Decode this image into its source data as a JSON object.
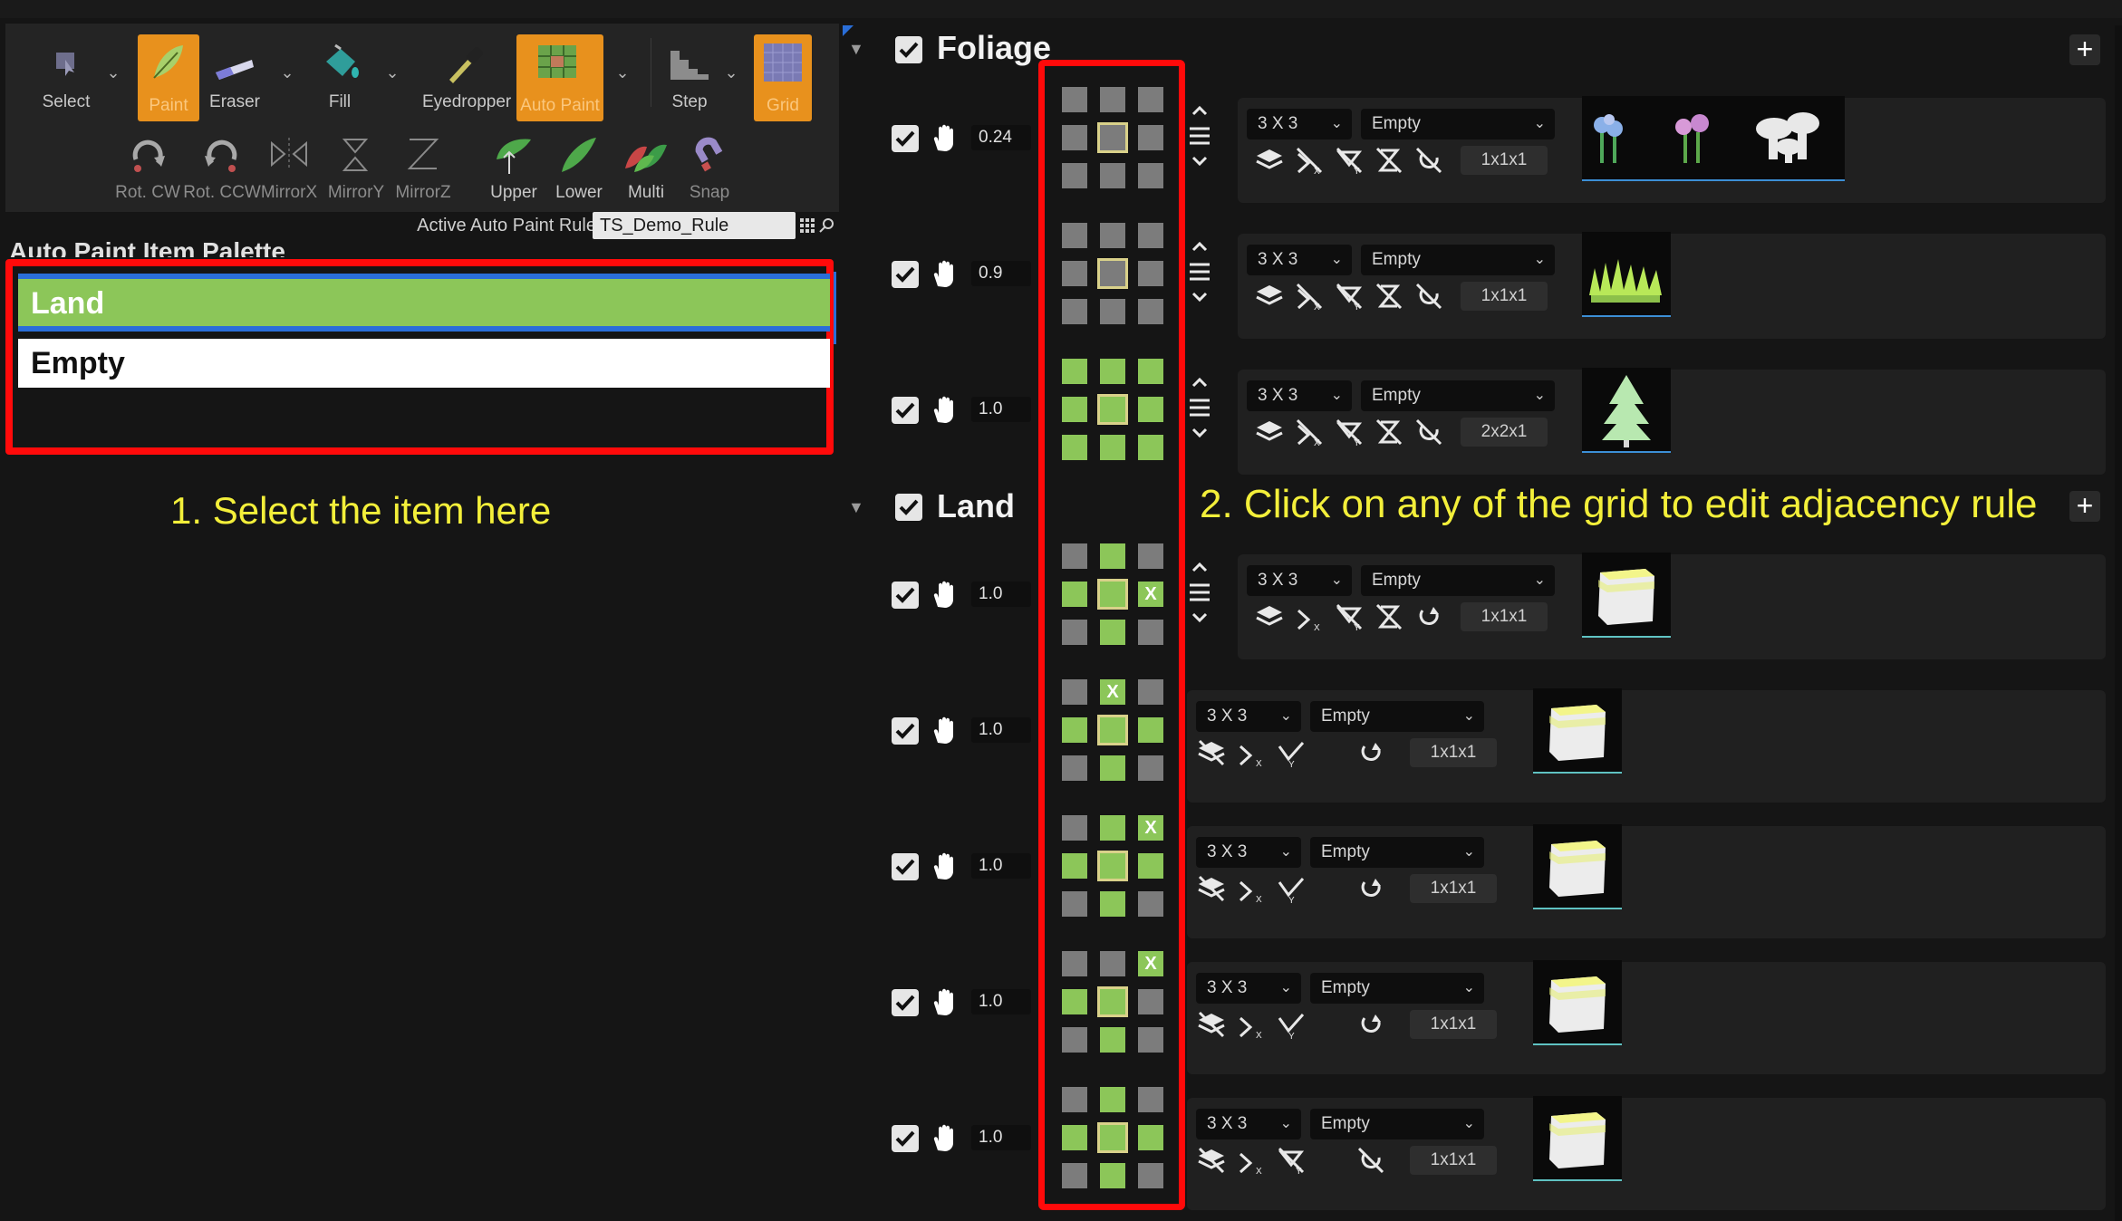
{
  "toolbar": {
    "tools": [
      {
        "label": "Select"
      },
      {
        "label": "Paint"
      },
      {
        "label": "Eraser"
      },
      {
        "label": "Fill"
      },
      {
        "label": "Eyedropper"
      },
      {
        "label": "Auto Paint"
      },
      {
        "label": "Step"
      },
      {
        "label": "Grid"
      }
    ],
    "transforms": [
      {
        "label": "Rot. CW"
      },
      {
        "label": "Rot. CCW"
      },
      {
        "label": "MirrorX"
      },
      {
        "label": "MirrorY"
      },
      {
        "label": "MirrorZ"
      },
      {
        "label": "Upper"
      },
      {
        "label": "Lower"
      },
      {
        "label": "Multi"
      },
      {
        "label": "Snap"
      }
    ],
    "active_rule_label": "Active Auto Paint Rule",
    "active_rule_value": "TS_Demo_Rule"
  },
  "palette": {
    "title": "Auto Paint Item Palette",
    "items": [
      {
        "label": "Land"
      },
      {
        "label": "Empty"
      }
    ]
  },
  "annotations": {
    "step1": "1. Select the item here",
    "step2": "2. Click on any of the grid to edit adjacency rule"
  },
  "sections": [
    {
      "title": "Foliage",
      "rules": [
        {
          "weight": "0.24",
          "size_combo": "3 X 3",
          "target_combo": "Empty",
          "size": "1x1x1"
        },
        {
          "weight": "0.9",
          "size_combo": "3 X 3",
          "target_combo": "Empty",
          "size": "1x1x1"
        },
        {
          "weight": "1.0",
          "size_combo": "3 X 3",
          "target_combo": "Empty",
          "size": "2x2x1"
        }
      ]
    },
    {
      "title": "Land",
      "rules": [
        {
          "weight": "1.0",
          "size_combo": "3 X 3",
          "target_combo": "Empty",
          "size": "1x1x1"
        },
        {
          "weight": "1.0",
          "size_combo": "3 X 3",
          "target_combo": "Empty",
          "size": "1x1x1"
        },
        {
          "weight": "1.0",
          "size_combo": "3 X 3",
          "target_combo": "Empty",
          "size": "1x1x1"
        },
        {
          "weight": "1.0",
          "size_combo": "3 X 3",
          "target_combo": "Empty",
          "size": "1x1x1"
        },
        {
          "weight": "1.0",
          "size_combo": "3 X 3",
          "target_combo": "Empty",
          "size": "1x1x1"
        }
      ]
    }
  ],
  "grid_legend": {
    "x_mark": "X"
  },
  "colors": {
    "accent_orange": "#e8911d",
    "land_green": "#8cc659",
    "highlight_red": "#ff0a0a",
    "annotation_yellow": "#f3ef3a",
    "cell_gray": "#7c7c7c"
  }
}
